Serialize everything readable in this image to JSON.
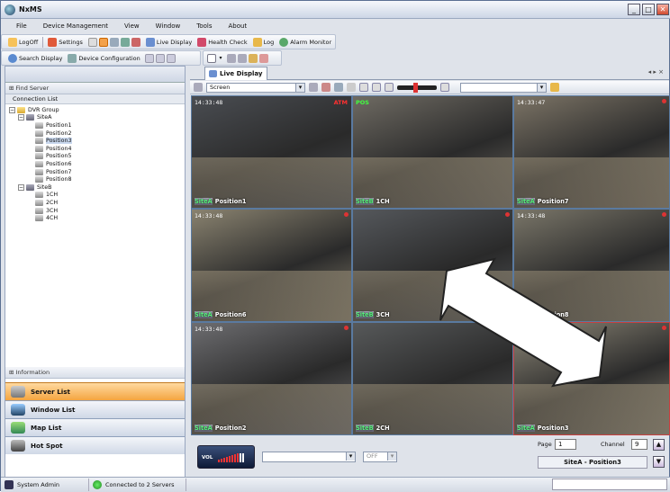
{
  "app": {
    "title": "NxMS"
  },
  "window_controls": {
    "minimize": "_",
    "maximize": "□",
    "close": "✕"
  },
  "menu": [
    "File",
    "Device Management",
    "View",
    "Window",
    "Tools",
    "About"
  ],
  "toolbar1": [
    "LogOff",
    "Settings",
    "Live Display",
    "Health Check",
    "Log",
    "Alarm Monitor"
  ],
  "toolbar2": [
    "Search Display",
    "Device Configuration"
  ],
  "left": {
    "find_server": "Find Server",
    "connection_list": "Connection List",
    "tree": [
      {
        "label": "DVR Group",
        "level": 0,
        "type": "folder",
        "exp": "−"
      },
      {
        "label": "SiteA",
        "level": 1,
        "type": "site",
        "exp": "−"
      },
      {
        "label": "Position1",
        "level": 2,
        "type": "cam"
      },
      {
        "label": "Position2",
        "level": 2,
        "type": "cam"
      },
      {
        "label": "Position3",
        "level": 2,
        "type": "cam",
        "selected": true
      },
      {
        "label": "Position4",
        "level": 2,
        "type": "cam"
      },
      {
        "label": "Position5",
        "level": 2,
        "type": "cam"
      },
      {
        "label": "Position6",
        "level": 2,
        "type": "cam"
      },
      {
        "label": "Position7",
        "level": 2,
        "type": "cam"
      },
      {
        "label": "Position8",
        "level": 2,
        "type": "cam"
      },
      {
        "label": "SiteB",
        "level": 1,
        "type": "site",
        "exp": "−"
      },
      {
        "label": "1CH",
        "level": 2,
        "type": "cam"
      },
      {
        "label": "2CH",
        "level": 2,
        "type": "cam"
      },
      {
        "label": "3CH",
        "level": 2,
        "type": "cam"
      },
      {
        "label": "4CH",
        "level": 2,
        "type": "cam"
      }
    ],
    "information": "Information",
    "nav": [
      "Server List",
      "Window List",
      "Map List",
      "Hot Spot"
    ]
  },
  "tab": {
    "label": "Live Display",
    "nav": "◂ ▸ ×"
  },
  "viewbar": {
    "screen": "Screen"
  },
  "cells": [
    {
      "ts": "14:33:48",
      "site": "SiteA",
      "name": "Position1",
      "tag": "ATM",
      "tagColor": "#ff3030",
      "bg": "#4a4d52"
    },
    {
      "ts": "",
      "site": "SiteB",
      "name": "1CH",
      "tag": "POS",
      "tagColor": "#40ff40",
      "tagLeft": true,
      "bg": "#6f6b63"
    },
    {
      "ts": "14:33:47",
      "site": "SiteA",
      "name": "Position7",
      "tag": "",
      "bg": "#7c7466"
    },
    {
      "ts": "14:33:48",
      "site": "SiteA",
      "name": "Position6",
      "tag": "",
      "bg": "#8a8370"
    },
    {
      "ts": "",
      "site": "SiteB",
      "name": "3CH",
      "tag": "",
      "bg": "#55585c"
    },
    {
      "ts": "14:33:48",
      "site": "SiteA",
      "name": "Position8",
      "tag": "",
      "bg": "#7a7669"
    },
    {
      "ts": "14:33:48",
      "site": "SiteA",
      "name": "Position2",
      "tag": "",
      "bg": "#6d6d70"
    },
    {
      "ts": "",
      "site": "SiteB",
      "name": "2CH",
      "tag": "",
      "bg": "#57595a"
    },
    {
      "ts": "",
      "site": "SiteA",
      "name": "Position3",
      "tag": "",
      "bg": "#8e8878",
      "highlight": true
    }
  ],
  "bottom": {
    "vol": "VOL",
    "off": "OFF",
    "page_label": "Page",
    "page_value": "1",
    "channel_label": "Channel",
    "channel_value": "9",
    "selected": "SiteA - Position3"
  },
  "status": {
    "user": "System Admin",
    "connection": "Connected to 2 Servers"
  }
}
